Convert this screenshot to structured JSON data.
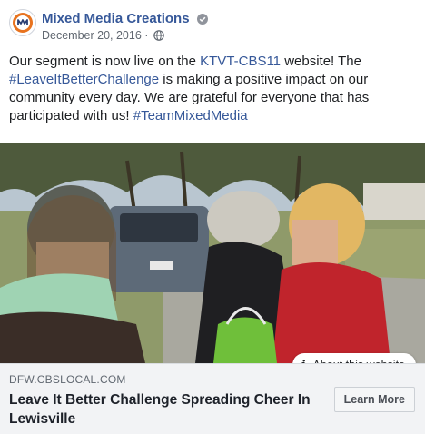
{
  "post": {
    "page_name": "Mixed Media Creations",
    "date": "December 20, 2016",
    "separator": " · ",
    "icons": {
      "avatar": "mixed-media-logo",
      "verified": "verified-badge-icon",
      "audience": "globe-icon"
    },
    "text": {
      "l1_a": "Our segment is now live on the ",
      "l1_link": "KTVT-CBS11",
      "l1_b": " website! The",
      "l2_tag": "#LeaveItBetterChallenge",
      "l2_rest": " is making a positive impact on our",
      "l3": "community every day. We are grateful for everyone that has",
      "l4_a": "participated with us! ",
      "l4_tag": "#TeamMixedMedia"
    }
  },
  "media": {
    "about_label": "About this website",
    "about_icon": "info-icon"
  },
  "link_card": {
    "domain": "DFW.CBSLOCAL.COM",
    "headline": "Leave It Better Challenge Spreading Cheer In Lewisville",
    "cta": "Learn More"
  },
  "colors": {
    "link": "#365899",
    "text": "#1c1e21",
    "secondary": "#606770",
    "card_bg": "#f2f3f5"
  }
}
